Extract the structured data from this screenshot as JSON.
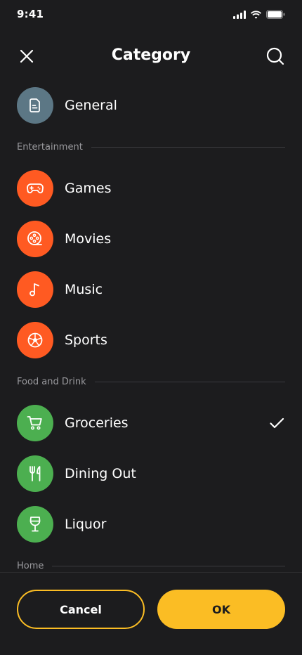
{
  "status_bar": {
    "time": "9:41"
  },
  "header": {
    "title": "Category"
  },
  "colors": {
    "general": "#5c7785",
    "entertainment": "#ff5a22",
    "food": "#4caf50",
    "accent": "#fbbd24"
  },
  "general": {
    "label": "General",
    "icon": "document-icon"
  },
  "sections": [
    {
      "title": "Entertainment",
      "items": [
        {
          "label": "Games",
          "icon": "gamepad-icon"
        },
        {
          "label": "Movies",
          "icon": "film-reel-icon"
        },
        {
          "label": "Music",
          "icon": "music-note-icon"
        },
        {
          "label": "Sports",
          "icon": "soccer-ball-icon"
        }
      ]
    },
    {
      "title": "Food and Drink",
      "items": [
        {
          "label": "Groceries",
          "icon": "shopping-cart-icon",
          "selected": true
        },
        {
          "label": "Dining Out",
          "icon": "fork-knife-icon"
        },
        {
          "label": "Liquor",
          "icon": "wine-glass-icon"
        }
      ]
    },
    {
      "title": "Home",
      "items": []
    }
  ],
  "footer": {
    "cancel_label": "Cancel",
    "ok_label": "OK"
  }
}
